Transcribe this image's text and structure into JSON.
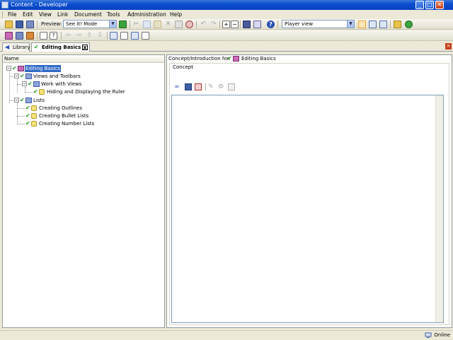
{
  "window": {
    "title": "Content - Developer",
    "buttons": {
      "minimize": "_",
      "maximize": "□",
      "close": "✕"
    }
  },
  "menu": [
    "File",
    "Edit",
    "View",
    "Link",
    "Document",
    "Tools",
    "Administration",
    "Help"
  ],
  "toolbar": {
    "preview_label": "Preview:",
    "preview_mode": "See It! Mode",
    "view_mode": "Player view"
  },
  "tabs": [
    {
      "label": "Library",
      "icon": "library-back-icon",
      "active": false
    },
    {
      "label": "Editing Basics",
      "icon": "outline-book-icon",
      "active": true,
      "close": "X"
    }
  ],
  "outline": {
    "column_header": "Name",
    "nodes": [
      {
        "label": "Editing Basics",
        "type": "module",
        "level": 0,
        "selected": true
      },
      {
        "label": "Views and Toolbars",
        "type": "section",
        "level": 1
      },
      {
        "label": "Work with Views",
        "type": "section",
        "level": 2
      },
      {
        "label": "Hiding and Displaying the Ruler",
        "type": "topic",
        "level": 3
      },
      {
        "label": "Lists",
        "type": "section",
        "level": 1
      },
      {
        "label": "Creating Outlines",
        "type": "topic",
        "level": 2
      },
      {
        "label": "Creating Bullet Lists",
        "type": "topic",
        "level": 2
      },
      {
        "label": "Creating Number Lists",
        "type": "topic",
        "level": 2
      }
    ]
  },
  "concept": {
    "header_label": "Concept/Introduction for:",
    "header_target": "Editing Basics",
    "group_label": "Concept",
    "toolbar_icons": [
      "link-icon",
      "save-icon",
      "delete-icon",
      "edit-icon",
      "unlink-icon",
      "properties-icon"
    ]
  },
  "status": {
    "connection": "Online"
  },
  "colors": {
    "titlebar": "#0a4ed0",
    "selection": "#316ac5",
    "check": "#1a9a1a",
    "chrome": "#ece9d8"
  }
}
